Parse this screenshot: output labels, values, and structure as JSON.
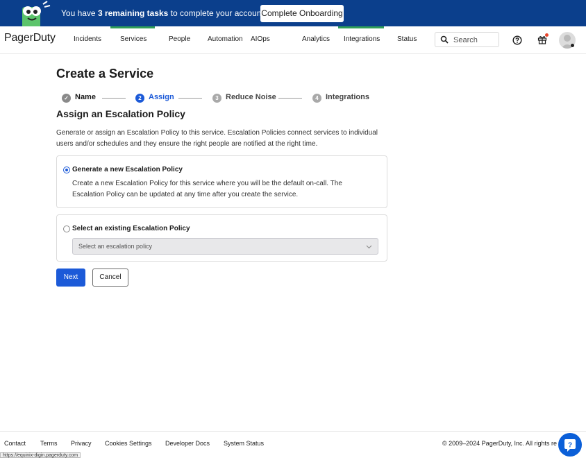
{
  "banner": {
    "prefix": "You have ",
    "bold": "3 remaining tasks",
    "suffix": " to complete your account set up",
    "cta_label": "Complete Onboarding",
    "mascot_icon": "pagerduty-mascot-icon"
  },
  "nav": {
    "logo": "PagerDuty",
    "items": [
      {
        "label": "Incidents"
      },
      {
        "label": "Services"
      },
      {
        "label": "People"
      },
      {
        "label": "Automation"
      },
      {
        "label": "AIOps"
      },
      {
        "label": "Analytics"
      },
      {
        "label": "Integrations"
      },
      {
        "label": "Status"
      }
    ],
    "search_placeholder": "Search",
    "icons": [
      "search-icon",
      "help-icon",
      "gift-icon",
      "avatar"
    ],
    "accent": "#2f9e58"
  },
  "main": {
    "title": "Create a Service",
    "steps": [
      {
        "number": "✓",
        "label": "Name",
        "state": "done"
      },
      {
        "number": "2",
        "label": "Assign",
        "state": "active"
      },
      {
        "number": "3",
        "label": "Reduce Noise",
        "state": "todo"
      },
      {
        "number": "4",
        "label": "Integrations",
        "state": "todo"
      }
    ],
    "section_title": "Assign an Escalation Policy",
    "description": "Generate or assign an Escalation Policy to this service. Escalation Policies connect services to individual users and/or schedules and they ensure the right people are notified at the right time.",
    "option_generate": {
      "title": "Generate a new Escalation Policy",
      "description": "Create a new Escalation Policy for this service where you will be the default on-call. The Escalation Policy can be updated at any time after you create the service.",
      "selected": true
    },
    "option_existing": {
      "title": "Select an existing Escalation Policy",
      "select_placeholder": "Select an escalation policy",
      "selected": false
    },
    "next_label": "Next",
    "cancel_label": "Cancel",
    "primary_color": "#1c5ad8"
  },
  "footer": {
    "links": [
      "Contact",
      "Terms",
      "Privacy",
      "Cookies Settings",
      "Developer Docs",
      "System Status"
    ],
    "copyright": "© 2009–2024 PagerDuty, Inc. All rights re",
    "status_url": "https://equinix-digin.pagerduty.com"
  }
}
